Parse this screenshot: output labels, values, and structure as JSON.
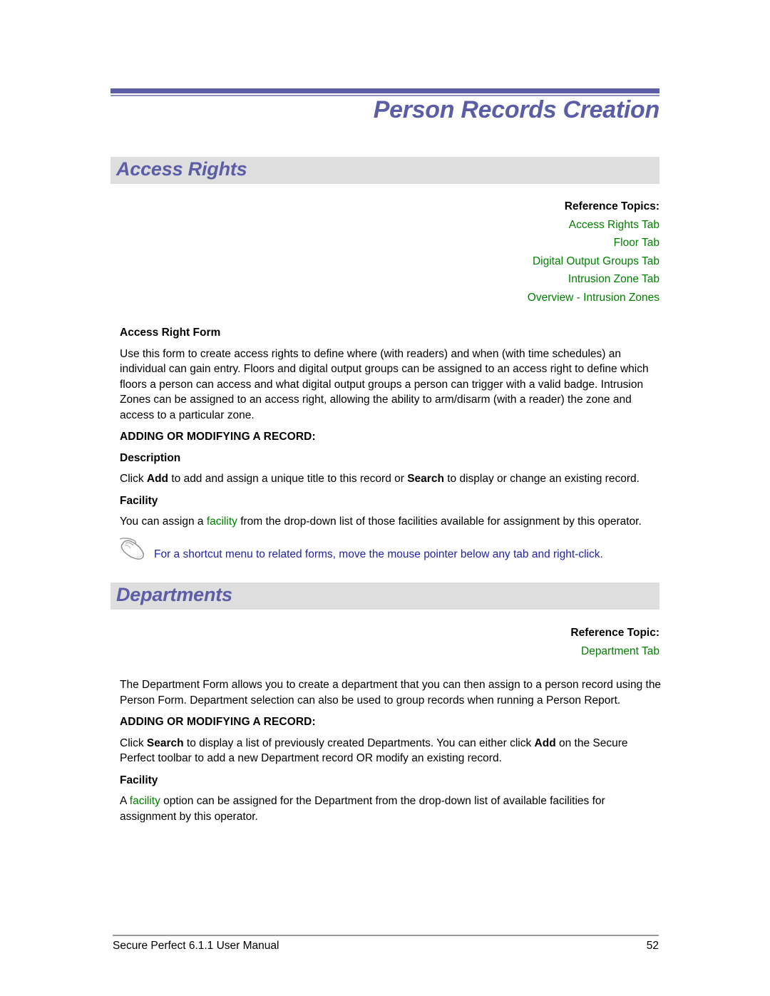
{
  "document": {
    "running_header_title": "Person Records Creation",
    "accent_color": "#5b5ea6",
    "band_color": "#dedede",
    "link_color": "#008000",
    "note_color": "#2222aa"
  },
  "sections": {
    "access_rights": {
      "band_title": "Access Rights",
      "reference": {
        "heading": "Reference Topics:",
        "links": [
          "Access Rights Tab",
          "Floor Tab",
          "Digital Output Groups Tab",
          "Intrusion Zone Tab",
          "Overview - Intrusion Zones"
        ]
      },
      "form_heading": "Access Right Form",
      "intro_paragraph": "Use this form to create access rights to define where (with readers) and when (with time schedules) an individual can gain entry. Floors and digital output groups can be assigned to an access right to define which floors a person can access and what digital output groups a person can trigger with a valid badge. Intrusion Zones can be assigned to an access right, allowing the ability to arm/disarm (with a reader) the zone and access to a particular zone.",
      "adding_heading": "ADDING OR MODIFYING A RECORD:",
      "description_heading": "Description",
      "description_text_1": "Click ",
      "description_bold_1": "Add",
      "description_text_2": " to add and assign a unique title to this record or ",
      "description_bold_2": "Search",
      "description_text_3": " to display or change an existing record.",
      "facility_heading": "Facility",
      "facility_text_1": "You can assign a ",
      "facility_link": "facility",
      "facility_text_2": " from the drop-down list of those facilities available for assignment by this operator.",
      "note_icon": "mouse-icon",
      "note_text": "For a shortcut menu to related forms, move the mouse pointer below any tab and right-click."
    },
    "departments": {
      "band_title": "Departments",
      "reference": {
        "heading": "Reference Topic:",
        "links": [
          "Department Tab"
        ]
      },
      "intro_paragraph": "The Department Form allows you to create a department that you can then assign to a person record using the Person Form. Department selection can also be used to group records when running a Person Report.",
      "adding_heading": "ADDING OR MODIFYING A RECORD:",
      "adding_text_1": "Click ",
      "adding_bold_1": "Search",
      "adding_text_2": " to display a list of previously created Departments. You can either click ",
      "adding_bold_2": "Add",
      "adding_text_3": " on the Secure Perfect toolbar to add a new Department record OR modify an existing record.",
      "facility_heading": "Facility",
      "facility_text_1": "A ",
      "facility_link": "facility",
      "facility_text_2": " option can be assigned for the Department from the drop-down list of available facilities for assignment by this operator."
    }
  },
  "footer": {
    "manual_title": "Secure Perfect 6.1.1 User Manual",
    "page_number": "52"
  }
}
